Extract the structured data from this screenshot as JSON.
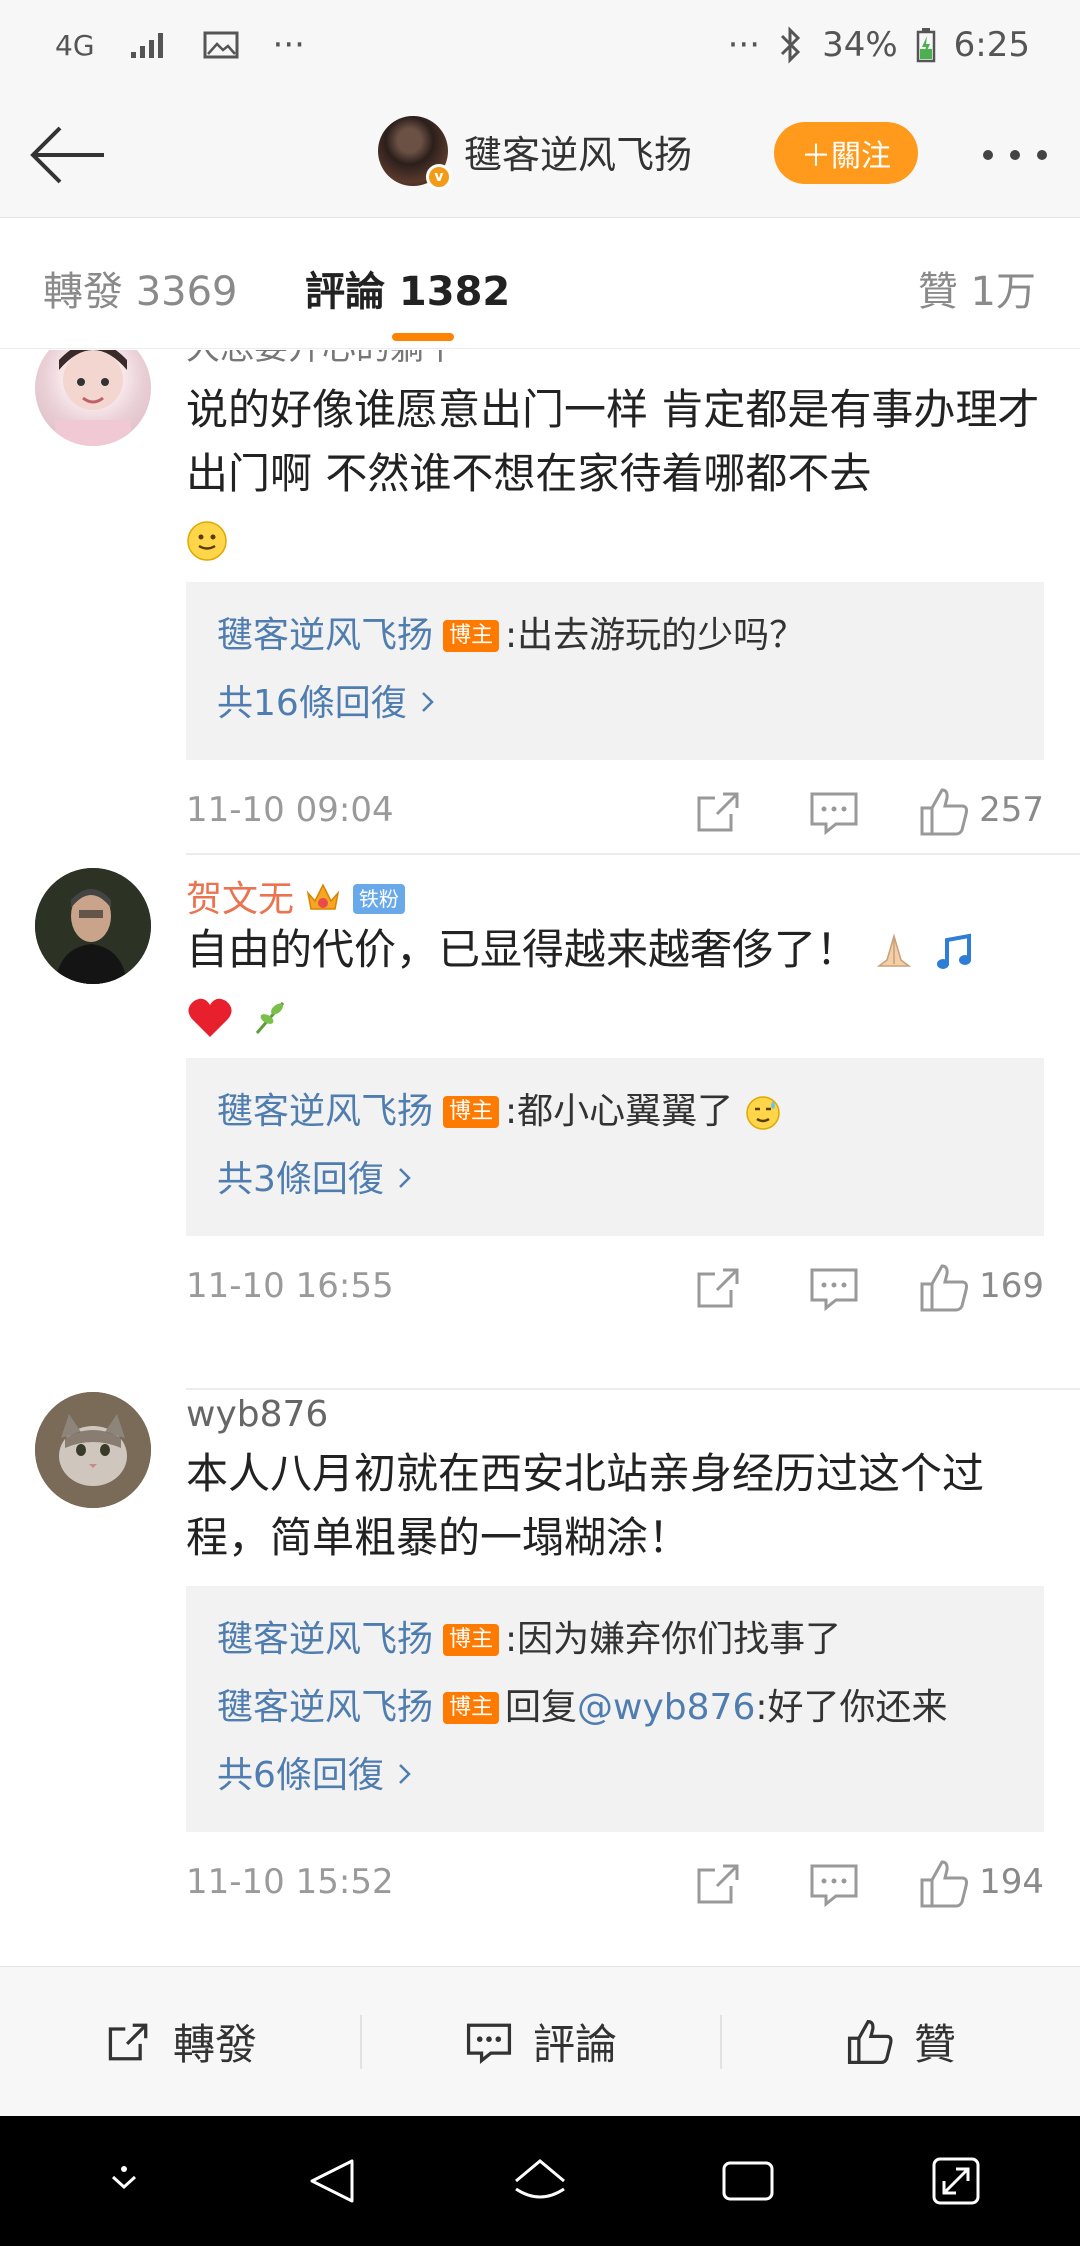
{
  "status_bar": {
    "network": "4G",
    "extra": "···",
    "right_dots": "···",
    "battery": "34%",
    "time": "6:25"
  },
  "header": {
    "name": "毽客逆风飞扬",
    "follow_label": "＋關注"
  },
  "tabs": {
    "repost": "轉發 3369",
    "comment": "評論 1382",
    "like": "贊 1万"
  },
  "comments": [
    {
      "name": "大恐要开心的躺下",
      "text": "说的好像谁愿意出门一样 肯定都是有事办理才出门啊 不然谁不想在家待着哪都不去",
      "replies": [
        {
          "name": "毽客逆风飞扬",
          "tag": "博主",
          "text": ":出去游玩的少吗？"
        }
      ],
      "more": "共16條回復",
      "time": "11-10 09:04",
      "likes": "257"
    },
    {
      "name": "贺文无",
      "badge": "铁粉",
      "text": "自由的代价，已显得越来越奢侈了！",
      "replies": [
        {
          "name": "毽客逆风飞扬",
          "tag": "博主",
          "text": ":都小心翼翼了"
        }
      ],
      "more": "共3條回復",
      "time": "11-10 16:55",
      "likes": "169"
    },
    {
      "name": "wyb876",
      "text": "本人八月初就在西安北站亲身经历过这个过程，简单粗暴的一塌糊涂！",
      "replies": [
        {
          "name": "毽客逆风飞扬",
          "tag": "博主",
          "text": ":因为嫌弃你们找事了"
        },
        {
          "name": "毽客逆风飞扬",
          "tag": "博主",
          "prefix": "回复",
          "mention": "@wyb876",
          "text": ":好了你还来"
        }
      ],
      "more": "共6條回復",
      "time": "11-10 15:52",
      "likes": "194"
    }
  ],
  "bottom_bar": {
    "repost": "轉發",
    "comment": "評論",
    "like": "贊"
  },
  "colors": {
    "accent_orange": "#ff8200",
    "follow_button": "#ff9a1d",
    "link_blue": "#507daf",
    "blogger_tag": "#ff7a00"
  }
}
